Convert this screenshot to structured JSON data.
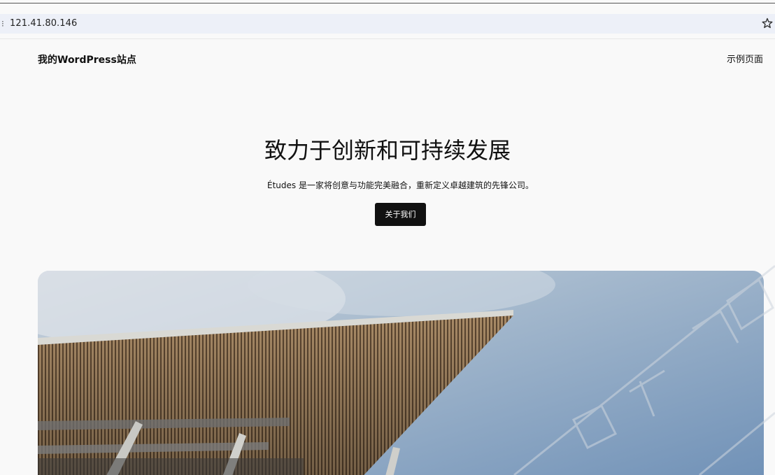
{
  "browser": {
    "url": "121.41.80.146",
    "left_glyph": "⁝",
    "star_icon": "star-icon"
  },
  "site": {
    "title": "我的WordPress站点",
    "nav": [
      {
        "label": "示例页面"
      }
    ]
  },
  "hero": {
    "heading": "致力于创新和可持续发展",
    "subheading": "Études 是一家将创意与功能完美融合，重新定义卓越建筑的先锋公司。",
    "button_label": "关于我们"
  },
  "colors": {
    "page_bg": "#f9f9f9",
    "button_bg": "#111111",
    "addressbar_bg": "#edf0f8",
    "sky_top": "#9eb4cc",
    "sky_bottom": "#6b8db4"
  }
}
